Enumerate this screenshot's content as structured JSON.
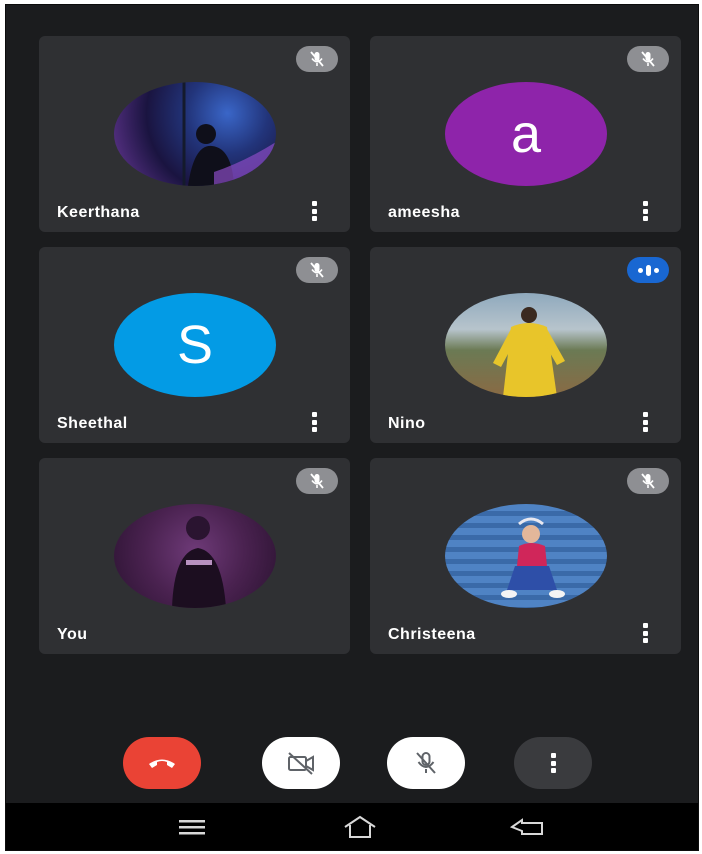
{
  "participants": [
    {
      "name": "Keerthana",
      "avatar_type": "photo",
      "mic": "muted",
      "has_menu": true
    },
    {
      "name": "ameesha",
      "avatar_type": "letter",
      "initial": "a",
      "avatar_color": "#8e24aa",
      "mic": "muted",
      "has_menu": true
    },
    {
      "name": "Sheethal",
      "avatar_type": "letter",
      "initial": "S",
      "avatar_color": "#039be5",
      "mic": "muted",
      "has_menu": true
    },
    {
      "name": "Nino",
      "avatar_type": "photo",
      "mic": "speaking",
      "has_menu": true
    },
    {
      "name": "You",
      "avatar_type": "photo",
      "mic": "muted",
      "has_menu": false
    },
    {
      "name": "Christeena",
      "avatar_type": "photo",
      "mic": "muted",
      "has_menu": true
    }
  ],
  "controls": {
    "end_call": {
      "icon": "phone-hangup-icon",
      "color": "#ea4335"
    },
    "camera": {
      "icon": "camera-off-icon",
      "state": "off"
    },
    "microphone": {
      "icon": "mic-off-icon",
      "state": "off"
    },
    "more": {
      "icon": "more-vert-icon"
    }
  },
  "navigation_bar": [
    "menu-icon",
    "home-icon",
    "back-icon"
  ],
  "colors": {
    "background": "#1b1c1e",
    "tile": "#2f3033",
    "muted_badge": "#8e8f93",
    "speaking_badge": "#1967d2"
  }
}
